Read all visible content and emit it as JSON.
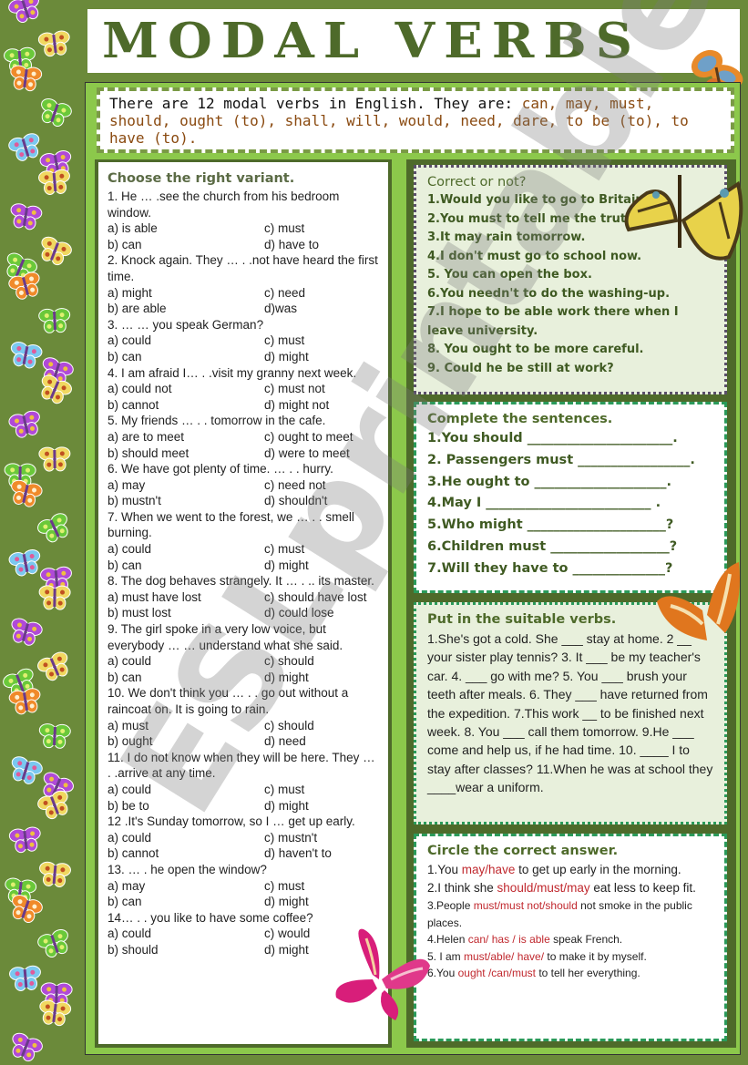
{
  "title": "MODAL VERBS",
  "intro": {
    "text": "There are 12 modal verbs in English. They are: ",
    "verbs": "can, may, must, should, ought (to), shall, will, would, need, dare, to be (to), to have (to)."
  },
  "choose_section": {
    "title": "Choose the right variant.",
    "questions": [
      {
        "q": "1. He … .see the church from his  bedroom window.",
        "a": "a) is able",
        "c": "c) must",
        "b": "b) can",
        "d": "d) have to"
      },
      {
        "q": "2. Knock again. They … . .not have heard the first time.",
        "a": "a) might",
        "c": "c) need",
        "b": "b) are able",
        "d": "d)was"
      },
      {
        "q": "3. … … you speak German?",
        "a": "a) could",
        "c": "c) must",
        "b": "b) can",
        "d": "d) might"
      },
      {
        "q": "4.  I am afraid I… . .visit my granny  next week.",
        "a": "a) could not",
        "c": "c) must not",
        "b": "b) cannot",
        "d": "d) might not"
      },
      {
        "q": "5. My friends … . . tomorrow in the cafe.",
        "a": "a) are to meet",
        "c": "c) ought to meet",
        "b": "b) should meet",
        "d": "d) were to meet"
      },
      {
        "q": "6. We have got plenty of time.  … . . hurry.",
        "a": "a) may",
        "c": "c) need not",
        "b": "b) mustn't",
        "d": "d)  shouldn't"
      },
      {
        "q": "7. When we went to the forest, we … . . smell burning.",
        "a": "a) could",
        "c": "c) must",
        "b": "b) can",
        "d": "d) might"
      },
      {
        "q": "8. The dog behaves strangely. It … . .. its master.",
        "a": "a) must have lost",
        "c": "c) should have lost",
        "b": "b) must lost",
        "d": "d) could lose"
      },
      {
        "q": "9.  The girl spoke in a very low voice, but everybody  … … understand  what she said.",
        "a": "a) could",
        "c": "c) should",
        "b": "b) can",
        "d": "d) might"
      },
      {
        "q": "10. We don't  think you … . . go out without a raincoat on. It is going to rain.",
        "a": "a) must",
        "c": "c) should",
        "b": "b) ought",
        "d": "d) need"
      },
      {
        "q": "11. I do not know when they will be here. They … . .arrive at any time.",
        "a": "a) could",
        "c": "c) must",
        "b": "b) be to",
        "d": "d) might"
      },
      {
        "q": "12 .It's Sunday tomorrow, so I … get up early.",
        "a": "a) could",
        "c": "c) mustn't",
        "b": "b) cannot",
        "d": "d) haven't to"
      },
      {
        "q": "13. … . he open the window?",
        "a": "a) may",
        "c": "c) must",
        "b": "b) can",
        "d": "d) might"
      },
      {
        "q": "14… . . you like to have some coffee?",
        "a": "a) could",
        "c": "c) would",
        "b": "b) should",
        "d": "d) might"
      }
    ]
  },
  "correct_section": {
    "title": "Correct or not?",
    "items": [
      "1.Would you like to go to Britain?",
      "2.You must to tell me the truth.",
      "3.It may rain tomorrow.",
      "4.I don't must go to school now.",
      "5. You can open the box.",
      "6.You needn't to do the washing-up.",
      "7.I hope to be able work there when I leave university.",
      "8. You ought to be more careful.",
      "9. Could he be still at work?"
    ]
  },
  "complete_section": {
    "title": "Complete the sentences.",
    "items": [
      "1.You should ______________________.",
      "2. Passengers must _________________.",
      "3.He ought to ____________________.",
      "4.May I _________________________ .",
      "5.Who might _____________________?",
      "6.Children must __________________?",
      "7.Will they have to ______________?"
    ]
  },
  "suitable_section": {
    "title": "Put in the suitable verbs.",
    "text": "1.She's got a cold. She ___ stay  at home.  2 __ your sister play tennis? 3. It ___ be my teacher's car.  4. ___ go with me? 5. You ___ brush your teeth after meals.  6. They ___ have returned from the expedition.  7.This work __ to be finished next week.  8. You ___ call them tomorrow.  9.He ___ come and help us, if he had time.  10. ____ I to stay after classes?  11.When he was at school they ____wear a uniform."
  },
  "circle_section": {
    "title": "Circle the correct answer.",
    "items": [
      {
        "pre": "1.You ",
        "choice": "may/have",
        "post": " to get up early in the morning."
      },
      {
        "pre": "2.I think she ",
        "choice": "should/must/may",
        "post": " eat less to keep fit."
      },
      {
        "pre": "3.People ",
        "choice": "must/must not/should",
        "post": " not smoke in the public places."
      },
      {
        "pre": "4.Helen ",
        "choice": "can/ has / is able",
        "post": " speak French."
      },
      {
        "pre": "5. I am  ",
        "choice": "must/able/ have/",
        "post": " to make it by myself."
      },
      {
        "pre": "6.You ",
        "choice": "ought /can/must",
        "post": " to tell her everything."
      }
    ]
  },
  "watermark": "ESLprintables.com",
  "colors": {
    "background": "#6b8a3a",
    "title": "#4e6a2a",
    "frame": "#8cc84b",
    "verb_highlight": "#8a4a10",
    "red_choice": "#c0282e",
    "dash_green": "#2a9a5a"
  }
}
